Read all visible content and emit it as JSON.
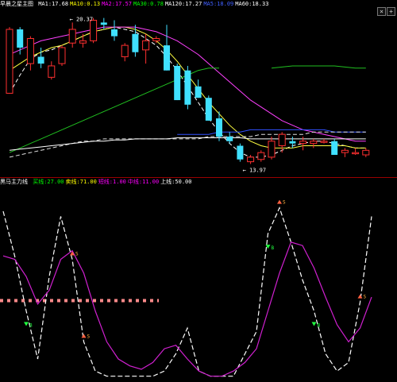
{
  "main_legend": {
    "title": "早晨之星主图",
    "items": [
      {
        "label": "MA1:",
        "value": "17.68",
        "color": "#ffffff"
      },
      {
        "label": "MA10:",
        "value": "0.13",
        "color": "#ffff00"
      },
      {
        "label": "MA2:",
        "value": "17.57",
        "color": "#ff00ff"
      },
      {
        "label": "MA30:",
        "value": "0.78",
        "color": "#00ff00"
      },
      {
        "label": "MA120:",
        "value": "17.27",
        "color": "#ffffff"
      },
      {
        "label": "MA5:",
        "value": "18.09",
        "color": "#4060ff"
      },
      {
        "label": "MA60:",
        "value": "18.33",
        "color": "#ffffff"
      }
    ],
    "labels_color": "#ffffff"
  },
  "price_annotations": {
    "high": "20.37",
    "low": "13.97"
  },
  "indicator_legend": {
    "title": "黑马主力线",
    "items": [
      {
        "label": "买线:",
        "value": "27.00",
        "color": "#00ff00"
      },
      {
        "label": "卖线:",
        "value": "71.00",
        "color": "#ffff00"
      },
      {
        "label": "短线:",
        "value": "1.00",
        "color": "#ff00ff"
      },
      {
        "label": "中线:",
        "value": "11.00",
        "color": "#ff00ff"
      },
      {
        "label": "上线:",
        "value": "50.00",
        "color": "#ffffff"
      }
    ]
  },
  "signal_labels": {
    "buy": "B",
    "sell": "S"
  },
  "controls": {
    "close": "×",
    "expand": "+"
  },
  "chart_data": [
    {
      "type": "candlestick",
      "panel": "main",
      "candles": [
        {
          "o": 17.0,
          "h": 19.9,
          "l": 17.0,
          "c": 19.8
        },
        {
          "o": 19.8,
          "h": 19.9,
          "l": 18.7,
          "c": 19.0
        },
        {
          "o": 18.3,
          "h": 19.5,
          "l": 18.0,
          "c": 19.4
        },
        {
          "o": 18.6,
          "h": 19.0,
          "l": 18.1,
          "c": 18.3
        },
        {
          "o": 17.7,
          "h": 18.4,
          "l": 17.6,
          "c": 18.2
        },
        {
          "o": 18.3,
          "h": 19.1,
          "l": 18.2,
          "c": 19.0
        },
        {
          "o": 19.2,
          "h": 20.1,
          "l": 19.0,
          "c": 19.8
        },
        {
          "o": 19.2,
          "h": 19.6,
          "l": 19.0,
          "c": 19.3
        },
        {
          "o": 19.3,
          "h": 20.3,
          "l": 19.2,
          "c": 20.2
        },
        {
          "o": 20.1,
          "h": 20.3,
          "l": 19.8,
          "c": 20.0
        },
        {
          "o": 19.8,
          "h": 20.2,
          "l": 19.3,
          "c": 19.5
        },
        {
          "o": 18.6,
          "h": 19.2,
          "l": 18.4,
          "c": 19.1
        },
        {
          "o": 19.6,
          "h": 20.0,
          "l": 18.6,
          "c": 18.8
        },
        {
          "o": 18.9,
          "h": 19.6,
          "l": 18.3,
          "c": 19.3
        },
        {
          "o": 19.3,
          "h": 19.5,
          "l": 19.2,
          "c": 19.4
        },
        {
          "o": 19.1,
          "h": 20.0,
          "l": 18.0,
          "c": 18.0
        },
        {
          "o": 18.2,
          "h": 18.3,
          "l": 16.7,
          "c": 16.7
        },
        {
          "o": 18.0,
          "h": 18.2,
          "l": 16.3,
          "c": 16.5
        },
        {
          "o": 17.3,
          "h": 17.6,
          "l": 16.8,
          "c": 16.8
        },
        {
          "o": 16.8,
          "h": 16.9,
          "l": 15.8,
          "c": 15.8
        },
        {
          "o": 15.9,
          "h": 16.2,
          "l": 14.9,
          "c": 15.1
        },
        {
          "o": 15.1,
          "h": 15.3,
          "l": 14.8,
          "c": 14.9
        },
        {
          "o": 14.7,
          "h": 14.8,
          "l": 14.0,
          "c": 14.1
        },
        {
          "o": 14.0,
          "h": 14.3,
          "l": 13.9,
          "c": 14.2
        },
        {
          "o": 14.1,
          "h": 14.5,
          "l": 14.0,
          "c": 14.4
        },
        {
          "o": 14.2,
          "h": 15.1,
          "l": 14.1,
          "c": 14.9
        },
        {
          "o": 14.7,
          "h": 15.3,
          "l": 14.4,
          "c": 15.2
        },
        {
          "o": 14.9,
          "h": 15.1,
          "l": 14.6,
          "c": 14.8
        },
        {
          "o": 14.8,
          "h": 15.1,
          "l": 14.5,
          "c": 14.9
        },
        {
          "o": 14.8,
          "h": 15.0,
          "l": 14.6,
          "c": 14.9
        },
        {
          "o": 14.9,
          "h": 15.0,
          "l": 14.8,
          "c": 14.9
        },
        {
          "o": 14.9,
          "h": 15.0,
          "l": 14.3,
          "c": 14.3
        },
        {
          "o": 14.4,
          "h": 14.6,
          "l": 14.2,
          "c": 14.5
        },
        {
          "o": 14.4,
          "h": 14.6,
          "l": 14.3,
          "c": 14.4
        },
        {
          "o": 14.3,
          "h": 14.6,
          "l": 14.2,
          "c": 14.5
        }
      ],
      "up_color": "#ff3030",
      "down_color": "#40e0ff",
      "ylim": [
        13.5,
        20.6
      ],
      "lines": [
        {
          "name": "MA1",
          "color": "#ffffff",
          "dash": true,
          "values": [
            17.0,
            17.8,
            18.5,
            18.8,
            18.9,
            19.1,
            19.3,
            19.5,
            19.7,
            19.8,
            19.9,
            19.8,
            19.7,
            19.4,
            19.1,
            18.6,
            18.0,
            17.3,
            16.6,
            15.9,
            15.3,
            14.8,
            14.4,
            14.2,
            14.2,
            14.3,
            14.5,
            14.7,
            14.8,
            14.9,
            14.9,
            14.8,
            14.7,
            14.6,
            14.6
          ]
        },
        {
          "name": "MA10",
          "color": "#ffff40",
          "values": [
            18.0,
            18.3,
            18.6,
            18.8,
            19.0,
            19.1,
            19.3,
            19.5,
            19.7,
            19.8,
            19.9,
            19.9,
            19.8,
            19.6,
            19.3,
            18.9,
            18.4,
            17.8,
            17.2,
            16.6,
            16.1,
            15.6,
            15.2,
            14.9,
            14.7,
            14.6,
            14.6,
            14.6,
            14.7,
            14.7,
            14.7,
            14.7,
            14.7,
            14.6,
            14.6
          ]
        },
        {
          "name": "MA2",
          "color": "#ff40ff",
          "values": [
            18.7,
            18.9,
            19.1,
            19.3,
            19.4,
            19.5,
            19.6,
            19.7,
            19.8,
            19.9,
            19.9,
            19.9,
            19.9,
            19.8,
            19.7,
            19.5,
            19.3,
            19.0,
            18.7,
            18.3,
            17.9,
            17.5,
            17.1,
            16.7,
            16.4,
            16.1,
            15.8,
            15.6,
            15.4,
            15.3,
            15.2,
            15.1,
            15.0,
            14.9,
            14.9
          ]
        },
        {
          "name": "MA30",
          "color": "#20c020",
          "values": [
            14.4,
            14.6,
            14.8,
            15.0,
            15.2,
            15.4,
            15.6,
            15.8,
            16.0,
            16.2,
            16.4,
            16.6,
            16.8,
            17.0,
            17.2,
            17.4,
            17.6,
            17.8,
            18.0,
            18.1,
            18.1,
            null,
            null,
            null,
            null,
            null,
            null,
            null,
            null,
            null,
            null,
            null,
            null,
            null,
            null
          ]
        },
        {
          "name": "MA30b",
          "color": "#20c020",
          "values": [
            null,
            null,
            null,
            null,
            null,
            null,
            null,
            null,
            null,
            null,
            null,
            null,
            null,
            null,
            null,
            null,
            null,
            null,
            null,
            null,
            null,
            null,
            null,
            null,
            null,
            18.1,
            18.15,
            18.2,
            18.2,
            18.2,
            18.2,
            18.2,
            18.15,
            18.1,
            18.1
          ]
        },
        {
          "name": "MA5",
          "color": "#3050ff",
          "values": [
            null,
            null,
            null,
            null,
            null,
            null,
            null,
            null,
            null,
            null,
            null,
            null,
            null,
            null,
            null,
            null,
            15.2,
            15.2,
            15.2,
            15.2,
            15.3,
            15.3,
            15.3,
            15.4,
            15.4,
            15.4,
            15.4,
            15.4,
            15.4,
            15.4,
            15.4,
            15.3,
            15.3,
            15.3,
            15.3
          ]
        },
        {
          "name": "MA120",
          "color": "#e0e0e0",
          "dash": true,
          "values": [
            14.2,
            14.3,
            14.4,
            14.5,
            14.6,
            14.7,
            14.8,
            14.9,
            14.9,
            15.0,
            15.0,
            15.0,
            15.0,
            15.0,
            15.0,
            15.0,
            15.0,
            15.0,
            15.0,
            15.1,
            15.1,
            15.1,
            15.1,
            15.1,
            15.2,
            15.2,
            15.2,
            15.2,
            15.2,
            15.3,
            15.3,
            15.3,
            15.3,
            15.3,
            15.3
          ]
        },
        {
          "name": "MA60",
          "color": "#ffffff",
          "values": [
            14.5,
            14.55,
            14.6,
            14.65,
            14.7,
            14.75,
            14.8,
            14.85,
            14.9,
            14.9,
            14.95,
            14.95,
            15.0,
            15.0,
            15.0,
            15.0,
            15.05,
            15.05,
            15.05,
            15.05,
            15.05,
            15.05,
            15.05,
            15.0,
            15.0,
            15.0,
            15.0,
            15.0,
            15.0,
            15.0,
            15.0,
            15.0,
            15.0,
            15.0,
            15.0
          ]
        }
      ]
    },
    {
      "type": "line",
      "panel": "indicator",
      "ylim": [
        0,
        110
      ],
      "series": [
        {
          "name": "短线",
          "color": "#ffffff",
          "dash": true,
          "values": [
            98,
            72,
            40,
            12,
            60,
            95,
            70,
            22,
            5,
            2,
            2,
            2,
            2,
            2,
            5,
            15,
            30,
            5,
            2,
            2,
            2,
            15,
            28,
            85,
            100,
            80,
            58,
            40,
            15,
            5,
            10,
            45,
            95
          ]
        },
        {
          "name": "中线",
          "color": "#d020d0",
          "values": [
            72,
            70,
            60,
            44,
            52,
            70,
            75,
            62,
            40,
            22,
            12,
            8,
            6,
            10,
            18,
            20,
            12,
            5,
            2,
            2,
            5,
            10,
            18,
            40,
            62,
            80,
            78,
            65,
            48,
            32,
            22,
            30,
            48
          ]
        }
      ],
      "buy_marks": [
        2,
        23,
        27,
        29
      ],
      "sell_marks": [
        6,
        7,
        24,
        31
      ],
      "reference_line": {
        "value": 46,
        "color": "#ff8a8a"
      }
    }
  ]
}
